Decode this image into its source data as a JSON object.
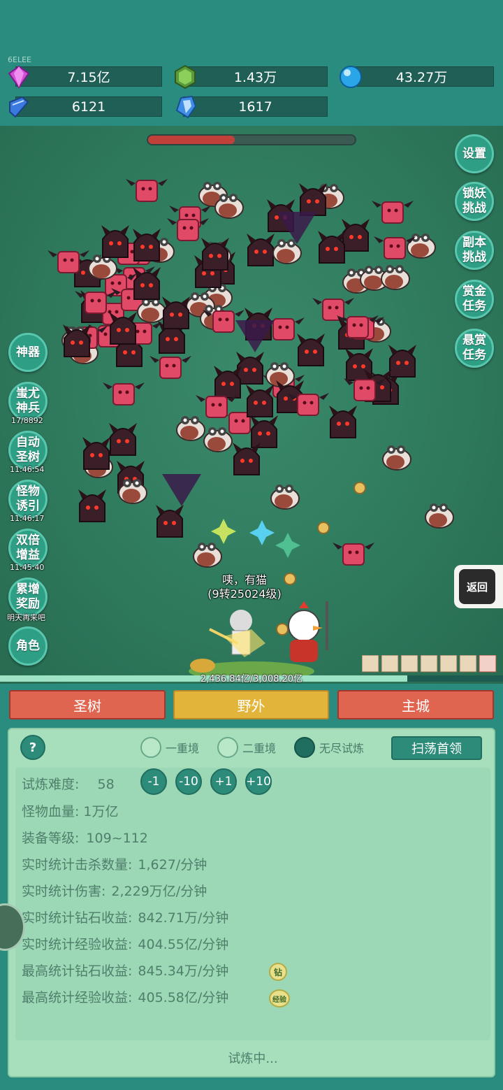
{
  "header": {
    "tiny_label": "6ELEE",
    "resources": [
      {
        "name": "gem",
        "icon": "purple-gem-icon",
        "value": "7.15亿"
      },
      {
        "name": "green-crystal",
        "icon": "green-crystal-icon",
        "value": "1.43万"
      },
      {
        "name": "blue-orb",
        "icon": "blue-orb-icon",
        "value": "43.27万"
      },
      {
        "name": "book",
        "icon": "blue-book-icon",
        "value": "6121"
      },
      {
        "name": "blue-crystal",
        "icon": "blue-crystal-icon",
        "value": "1617"
      }
    ]
  },
  "battle": {
    "boss_hp_fraction": 0.42,
    "right_buttons": {
      "settings": "设置",
      "lock_demon_1": "锁妖",
      "lock_demon_2": "挑战",
      "dungeon_1": "副本",
      "dungeon_2": "挑战",
      "bounty_1": "赏金",
      "bounty_2": "任务",
      "reward_1": "悬赏",
      "reward_2": "任务"
    },
    "left_buttons": {
      "artifact": "神器",
      "chiyou_1": "蚩尤",
      "chiyou_2": "神兵",
      "chiyou_timer": "17/8892",
      "auto_tree_1": "自动",
      "auto_tree_2": "圣树",
      "auto_tree_timer": "11:46:54",
      "lure_1": "怪物",
      "lure_2": "诱引",
      "lure_timer": "11:46:17",
      "double_1": "双倍",
      "double_2": "增益",
      "double_timer": "11:45:40",
      "accum_1": "累增",
      "accum_2": "奖励",
      "accum_note": "明天再来吧",
      "character": "角色"
    },
    "return_label": "返回",
    "speech_line1": "咦，有猫",
    "speech_line2": "(9转25024级)",
    "exp_text": "2,436.84亿/3,008.20亿",
    "exp_fraction": 0.81
  },
  "tabs": {
    "tree": "圣树",
    "field": "野外",
    "city": "主城"
  },
  "panel": {
    "help": "?",
    "mode_1": "一重境",
    "mode_2": "二重境",
    "mode_3": "无尽试炼",
    "sweep": "扫荡首领",
    "difficulty_label": "试炼难度:",
    "difficulty_value": "58",
    "adj_minus1": "-1",
    "adj_minus10": "-10",
    "adj_plus1": "+1",
    "adj_plus10": "+10",
    "monster_hp_label": "怪物血量:",
    "monster_hp_value": "1万亿",
    "equip_level_label": "装备等级:",
    "equip_level_value": "109~112",
    "kills_label": "实时统计击杀数量:",
    "kills_value": "1,627/分钟",
    "damage_label": "实时统计伤害:",
    "damage_value": "2,229万亿/分钟",
    "diamond_rt_label": "实时统计钻石收益:",
    "diamond_rt_value": "842.71万/分钟",
    "exp_rt_label": "实时统计经验收益:",
    "exp_rt_value": "404.55亿/分钟",
    "diamond_max_label": "最高统计钻石收益:",
    "diamond_max_value": "845.34万/分钟",
    "diamond_badge": "钻",
    "exp_max_label": "最高统计经验收益:",
    "exp_max_value": "405.58亿/分钟",
    "exp_badge": "经验",
    "status": "试炼中..."
  },
  "colors": {
    "bg": "#2a8c7e",
    "tab_red": "#e06551",
    "tab_gold": "#e2b53a",
    "panel": "#a7dfbd",
    "boss_hp": "#c0413a"
  }
}
